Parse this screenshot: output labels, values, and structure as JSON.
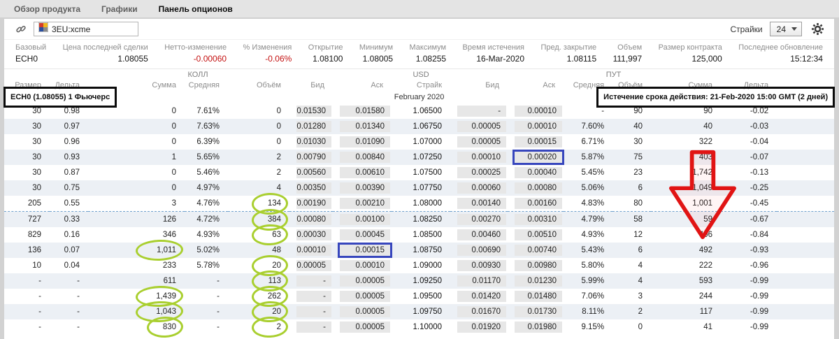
{
  "tabs": [
    {
      "label": "Обзор продукта"
    },
    {
      "label": "Графики"
    },
    {
      "label": "Панель опционов"
    }
  ],
  "toolbar": {
    "symbol": "3EU:xcme",
    "strikes_label": "Страйки",
    "strikes_value": "24"
  },
  "quote": {
    "fields": [
      {
        "label": "Базовый",
        "value": "ECH0"
      },
      {
        "label": "Цена последней сделки",
        "value": "1.08055"
      },
      {
        "label": "Нетто-изменение",
        "value": "-0.00060",
        "negative": true
      },
      {
        "label": "% Изменения",
        "value": "-0.06%",
        "negative": true
      },
      {
        "label": "Открытие",
        "value": "1.08100"
      },
      {
        "label": "Минимум",
        "value": "1.08005"
      },
      {
        "label": "Максимум",
        "value": "1.08255"
      },
      {
        "label": "Время истечения",
        "value": "16-Mar-2020"
      },
      {
        "label": "Пред. закрытие",
        "value": "1.08115"
      },
      {
        "label": "Объем",
        "value": "111,997"
      },
      {
        "label": "Размер контракта",
        "value": "125,000"
      },
      {
        "label": "Последнее обновление",
        "value": "15:12:34"
      }
    ]
  },
  "table": {
    "group_call": "КОЛЛ",
    "group_center": "USD",
    "group_put": "ПУТ",
    "columns": [
      "Размер",
      "Дельта",
      "Сумма",
      "Средняя",
      "Объём",
      "Бид",
      "Аск",
      "Страйк",
      "Бид",
      "Аск",
      "Средняя",
      "Объём",
      "Сумма",
      "Дельта"
    ],
    "month_header": "February 2020",
    "futures_info": "ECH0 (1.08055) 1 Фьючерс",
    "expiry_info": "Истечение срока действия: 21-Feb-2020 15:00 GMT (2 дней)",
    "price_line_after_row": 7,
    "rows": [
      [
        "30",
        "0.98",
        "0",
        "7.61%",
        "0",
        "0.01530",
        "0.01580",
        "1.06500",
        "-",
        "0.00010",
        "-",
        "90",
        "90",
        "-0.02"
      ],
      [
        "30",
        "0.97",
        "0",
        "7.63%",
        "0",
        "0.01280",
        "0.01340",
        "1.06750",
        "0.00005",
        "0.00010",
        "7.60%",
        "40",
        "40",
        "-0.03"
      ],
      [
        "30",
        "0.96",
        "0",
        "6.39%",
        "0",
        "0.01030",
        "0.01090",
        "1.07000",
        "0.00005",
        "0.00015",
        "6.71%",
        "30",
        "322",
        "-0.04"
      ],
      [
        "30",
        "0.93",
        "1",
        "5.65%",
        "2",
        "0.00790",
        "0.00840",
        "1.07250",
        "0.00010",
        "0.00020",
        "5.87%",
        "75",
        "403",
        "-0.07"
      ],
      [
        "30",
        "0.87",
        "0",
        "5.46%",
        "2",
        "0.00560",
        "0.00610",
        "1.07500",
        "0.00025",
        "0.00040",
        "5.45%",
        "23",
        "1,742",
        "-0.13"
      ],
      [
        "30",
        "0.75",
        "0",
        "4.97%",
        "4",
        "0.00350",
        "0.00390",
        "1.07750",
        "0.00060",
        "0.00080",
        "5.06%",
        "6",
        "1,049",
        "-0.25"
      ],
      [
        "205",
        "0.55",
        "3",
        "4.76%",
        "134",
        "0.00190",
        "0.00210",
        "1.08000",
        "0.00140",
        "0.00160",
        "4.83%",
        "80",
        "1,001",
        "-0.45"
      ],
      [
        "727",
        "0.33",
        "126",
        "4.72%",
        "384",
        "0.00080",
        "0.00100",
        "1.08250",
        "0.00270",
        "0.00310",
        "4.79%",
        "58",
        "59",
        "-0.67"
      ],
      [
        "829",
        "0.16",
        "346",
        "4.93%",
        "63",
        "0.00030",
        "0.00045",
        "1.08500",
        "0.00460",
        "0.00510",
        "4.93%",
        "12",
        "406",
        "-0.84"
      ],
      [
        "136",
        "0.07",
        "1,011",
        "5.02%",
        "48",
        "0.00010",
        "0.00015",
        "1.08750",
        "0.00690",
        "0.00740",
        "5.43%",
        "6",
        "492",
        "-0.93"
      ],
      [
        "10",
        "0.04",
        "233",
        "5.78%",
        "20",
        "0.00005",
        "0.00010",
        "1.09000",
        "0.00930",
        "0.00980",
        "5.80%",
        "4",
        "222",
        "-0.96"
      ],
      [
        "-",
        "-",
        "611",
        "-",
        "113",
        "-",
        "0.00005",
        "1.09250",
        "0.01170",
        "0.01230",
        "5.99%",
        "4",
        "593",
        "-0.99"
      ],
      [
        "-",
        "-",
        "1,439",
        "-",
        "262",
        "-",
        "0.00005",
        "1.09500",
        "0.01420",
        "0.01480",
        "7.06%",
        "3",
        "244",
        "-0.99"
      ],
      [
        "-",
        "-",
        "1,043",
        "-",
        "20",
        "-",
        "0.00005",
        "1.09750",
        "0.01670",
        "0.01730",
        "8.11%",
        "2",
        "117",
        "-0.99"
      ],
      [
        "-",
        "-",
        "830",
        "-",
        "2",
        "-",
        "0.00005",
        "1.10000",
        "0.01920",
        "0.01980",
        "9.15%",
        "0",
        "41",
        "-0.99"
      ]
    ]
  },
  "annotations": {
    "green_circles": [
      {
        "row": 6,
        "col": 4
      },
      {
        "row": 7,
        "col": 4
      },
      {
        "row": 8,
        "col": 4
      },
      {
        "row": 9,
        "col": 2
      },
      {
        "row": 10,
        "col": 4
      },
      {
        "row": 11,
        "col": 4
      },
      {
        "row": 12,
        "col": 2
      },
      {
        "row": 12,
        "col": 4
      },
      {
        "row": 13,
        "col": 2
      },
      {
        "row": 13,
        "col": 4
      },
      {
        "row": 14,
        "col": 2
      },
      {
        "row": 14,
        "col": 4
      }
    ],
    "blue_boxes": [
      {
        "row": 3,
        "col": 9
      },
      {
        "row": 9,
        "col": 6
      }
    ],
    "red_arrow": {
      "col": 12,
      "from_row": 3,
      "to_row": 8
    },
    "black_boxes": [
      "futures-info",
      "expiry-info"
    ]
  },
  "colors": {
    "negative": "#c41111",
    "annotation_green": "#a9cf2f",
    "annotation_blue": "#3746bd",
    "annotation_red": "#e11414",
    "annotation_black": "#0b0b0b"
  }
}
